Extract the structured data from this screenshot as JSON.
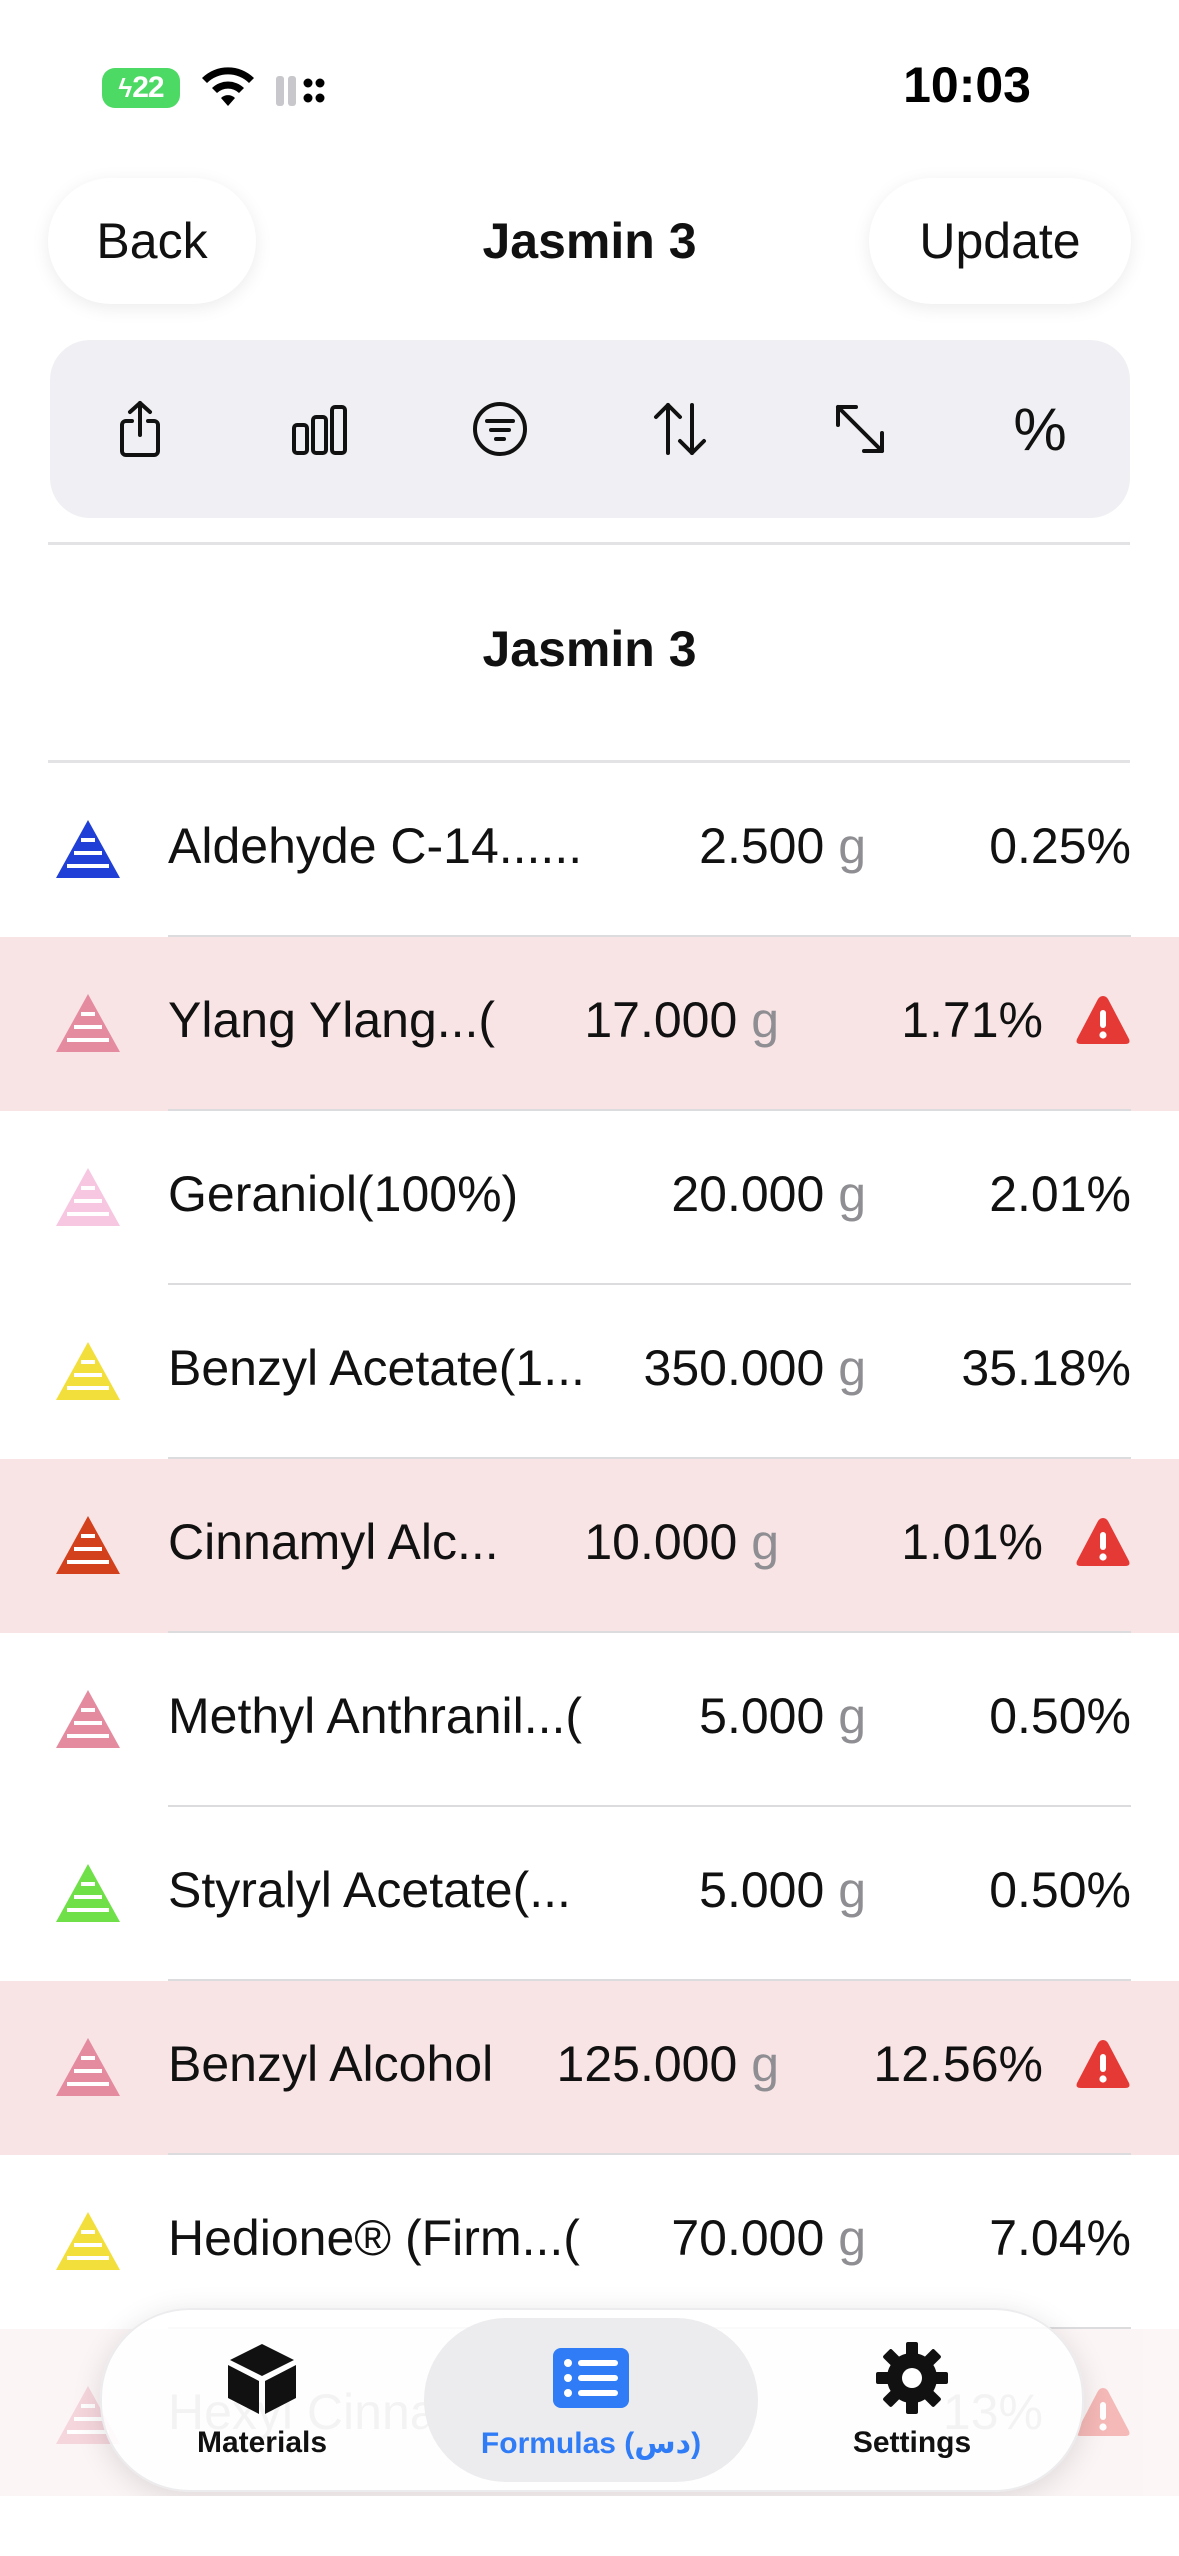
{
  "status_bar": {
    "battery": "22",
    "time": "10:03"
  },
  "header": {
    "back_label": "Back",
    "title": "Jasmin 3",
    "update_label": "Update"
  },
  "toolbar": {
    "percent_label": "%"
  },
  "formula": {
    "heading": "Jasmin 3"
  },
  "colors": {
    "warning_row": "#f9e4e5",
    "alert": "#e53935",
    "accent": "#2f7cf6"
  },
  "rows": [
    {
      "name": "Aldehyde C-14......",
      "amount": "2.500",
      "unit": "g",
      "percent": "0.25%",
      "warn": false,
      "color": "#1f3fd6"
    },
    {
      "name": "Ylang Ylang...(",
      "amount": "17.000",
      "unit": "g",
      "percent": "1.71%",
      "warn": true,
      "color": "#e58ba0"
    },
    {
      "name": "Geraniol(100%)",
      "amount": "20.000",
      "unit": "g",
      "percent": "2.01%",
      "warn": false,
      "color": "#f7c6e1"
    },
    {
      "name": "Benzyl Acetate(1...",
      "amount": "350.000",
      "unit": "g",
      "percent": "35.18%",
      "warn": false,
      "color": "#f3df3c"
    },
    {
      "name": "Cinnamyl Alc...",
      "amount": "10.000",
      "unit": "g",
      "percent": "1.01%",
      "warn": true,
      "color": "#d3401c"
    },
    {
      "name": "Methyl Anthranil...(",
      "amount": "5.000",
      "unit": "g",
      "percent": "0.50%",
      "warn": false,
      "color": "#e58ba0"
    },
    {
      "name": "Styralyl Acetate(...",
      "amount": "5.000",
      "unit": "g",
      "percent": "0.50%",
      "warn": false,
      "color": "#6fe048"
    },
    {
      "name": "Benzyl Alcohol",
      "amount": "125.000",
      "unit": "g",
      "percent": "12.56%",
      "warn": true,
      "color": "#e58ba0"
    },
    {
      "name": "Hedione® (Firm...(",
      "amount": "70.000",
      "unit": "g",
      "percent": "7.04%",
      "warn": false,
      "color": "#f3df3c"
    },
    {
      "name": "Hexyl Cinna...",
      "amount": "",
      "unit": "",
      "percent": "13%",
      "warn": true,
      "color": "#e58ba0"
    }
  ],
  "tabs": [
    {
      "label": "Materials",
      "icon": "cube-icon"
    },
    {
      "label": "Formulas (دس)",
      "icon": "list-icon"
    },
    {
      "label": "Settings",
      "icon": "gear-icon"
    }
  ]
}
